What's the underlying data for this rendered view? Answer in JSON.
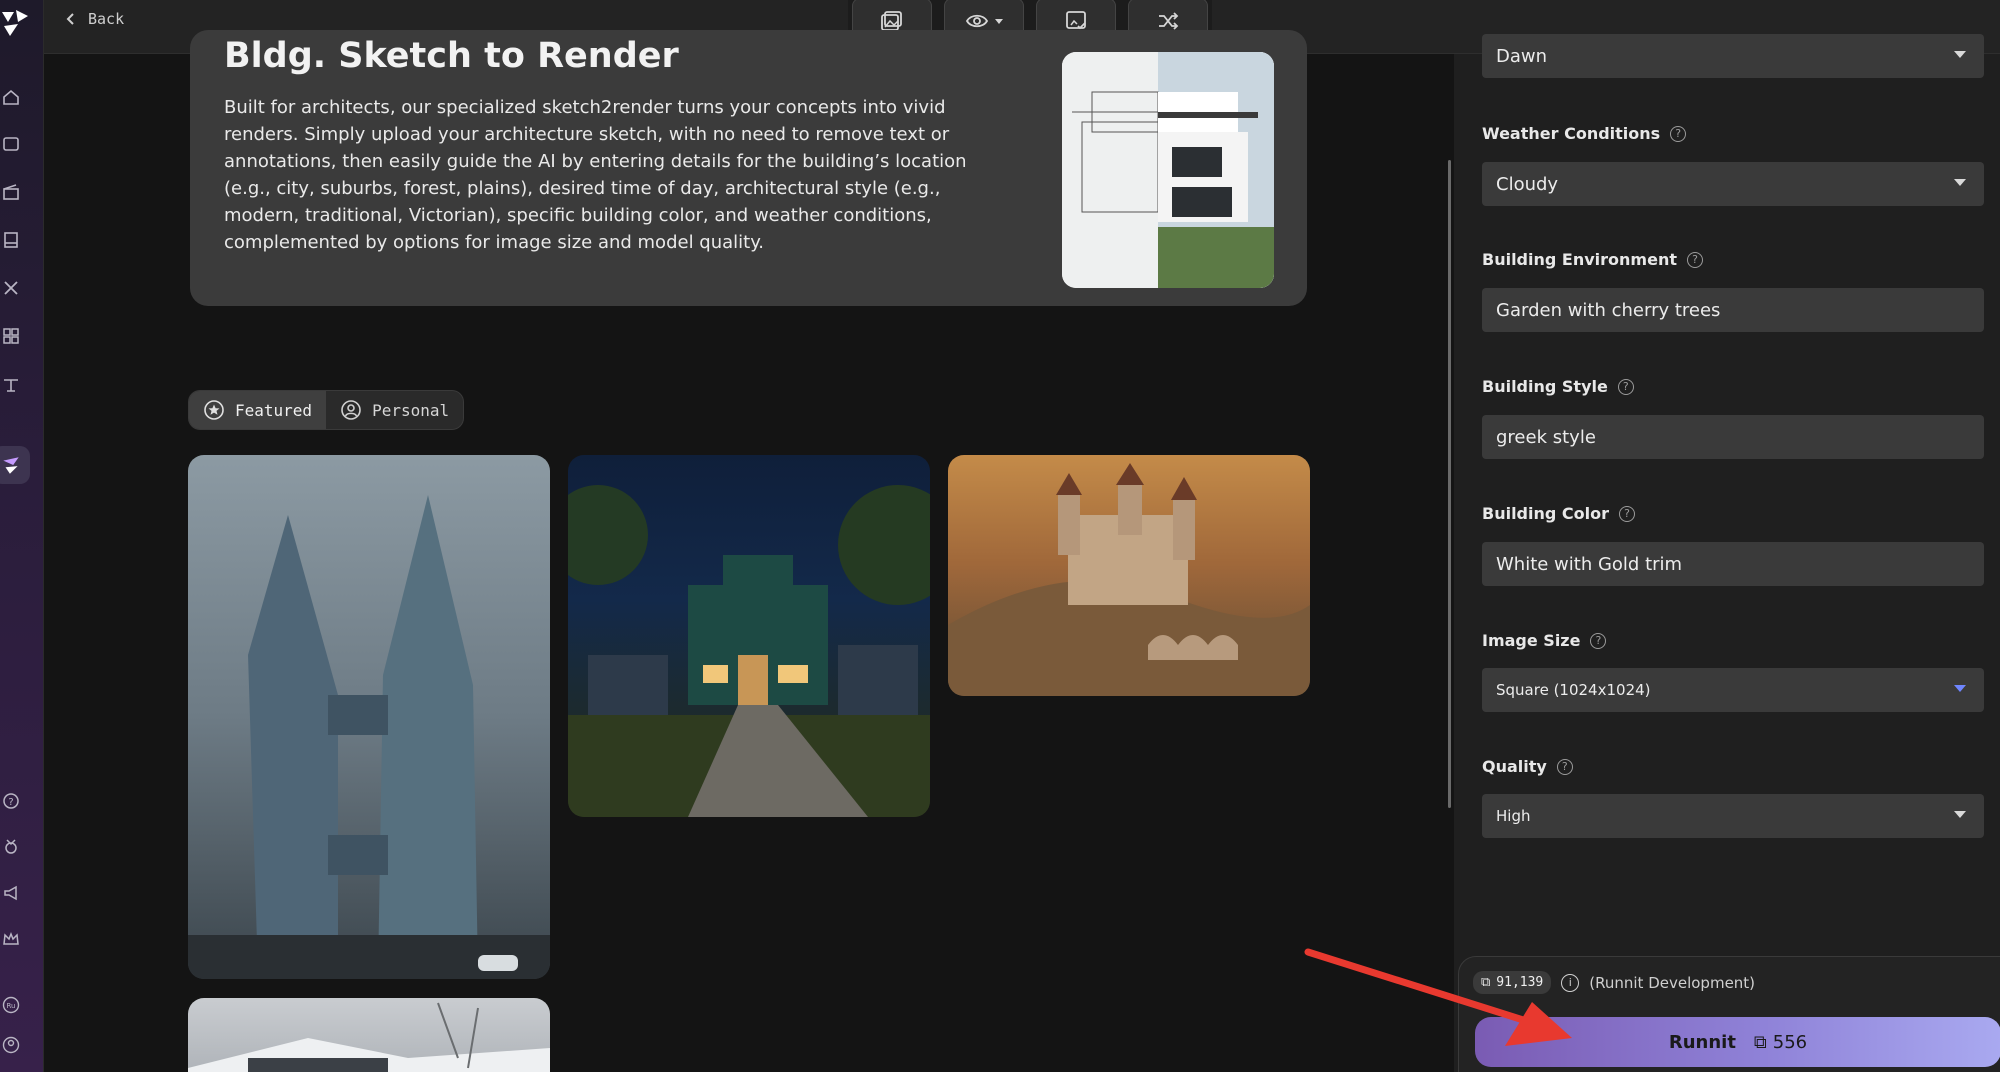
{
  "topbar": {
    "back_label": "Back"
  },
  "card": {
    "title": "Bldg. Sketch to Render",
    "description": "Built for architects, our specialized sketch2render turns your concepts into vivid renders. Simply upload your architecture sketch, with no need to remove text or annotations, then easily guide the AI by entering details for the building’s location (e.g., city, suburbs, forest, plains), desired time of day, architectural style (e.g., modern, traditional, Victorian), specific building color, and weather conditions, complemented by options for image size and model quality."
  },
  "segments": {
    "featured": "Featured",
    "personal": "Personal"
  },
  "panel": {
    "time_of_day_value": "Dawn",
    "weather_label": "Weather Conditions",
    "weather_value": "Cloudy",
    "environment_label": "Building Environment",
    "environment_value": "Garden with cherry trees",
    "style_label": "Building Style",
    "style_value": "greek style",
    "color_label": "Building Color",
    "color_value": "White with Gold trim",
    "size_label": "Image Size",
    "size_value": "Square (1024x1024)",
    "quality_label": "Quality",
    "quality_value": "High"
  },
  "footer": {
    "credits": "91,139",
    "workspace": "(Runnit Development)",
    "run_label": "Runnit",
    "run_cost": "556"
  },
  "colors": {
    "accent": "#8f82d8",
    "arrow": "#e8392f"
  }
}
